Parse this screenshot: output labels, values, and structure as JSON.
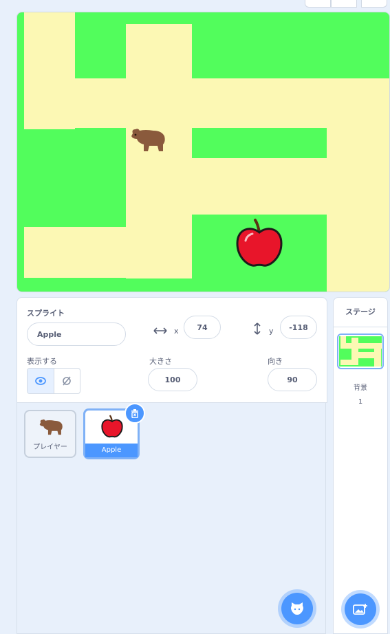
{
  "sprite_panel": {
    "title": "スプライト",
    "name": "Apple",
    "x_label": "x",
    "x_value": "74",
    "y_label": "y",
    "y_value": "-118",
    "show_label": "表示する",
    "size_label": "大きさ",
    "size_value": "100",
    "direction_label": "向き",
    "direction_value": "90"
  },
  "sprite_list": [
    {
      "name": "プレイヤー",
      "icon": "bear-icon",
      "selected": false
    },
    {
      "name": "Apple",
      "icon": "apple-icon",
      "selected": true
    }
  ],
  "stage_panel": {
    "title": "ステージ",
    "backdrop_label": "背景",
    "backdrop_count": "1"
  },
  "colors": {
    "grass": "#52fd5c",
    "path": "#fcf8b4",
    "accent": "#4c97ff",
    "text": "#575e75"
  }
}
